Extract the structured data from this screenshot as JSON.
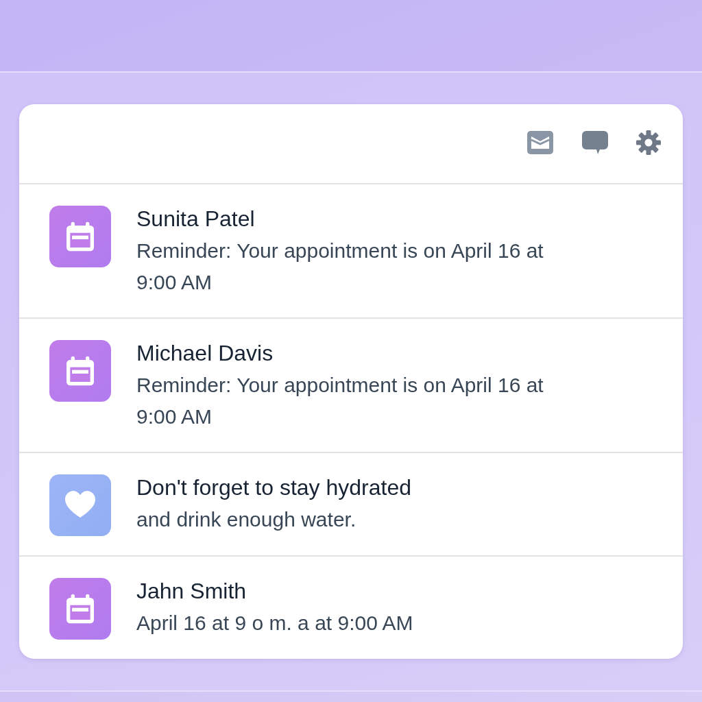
{
  "toolbar": {
    "buttons": [
      {
        "kind": "inbox"
      },
      {
        "kind": "chat"
      },
      {
        "kind": "settings"
      }
    ]
  },
  "notifications": [
    {
      "kind": "calendar",
      "title": "Sunita Patel",
      "body": "Reminder: Your appointment is on April 16 at 9:00 AM"
    },
    {
      "kind": "calendar",
      "title": "Michael Davis",
      "body": "Reminder: Your appointment is on April 16 at 9:00 AM"
    },
    {
      "kind": "heart",
      "title": "Don't forget to stay hydrated",
      "body": "and drink enough water."
    },
    {
      "kind": "calendar",
      "title": "Jahn Smith",
      "body": "April 16 at 9 o m. a at 9:00 AM"
    }
  ]
}
